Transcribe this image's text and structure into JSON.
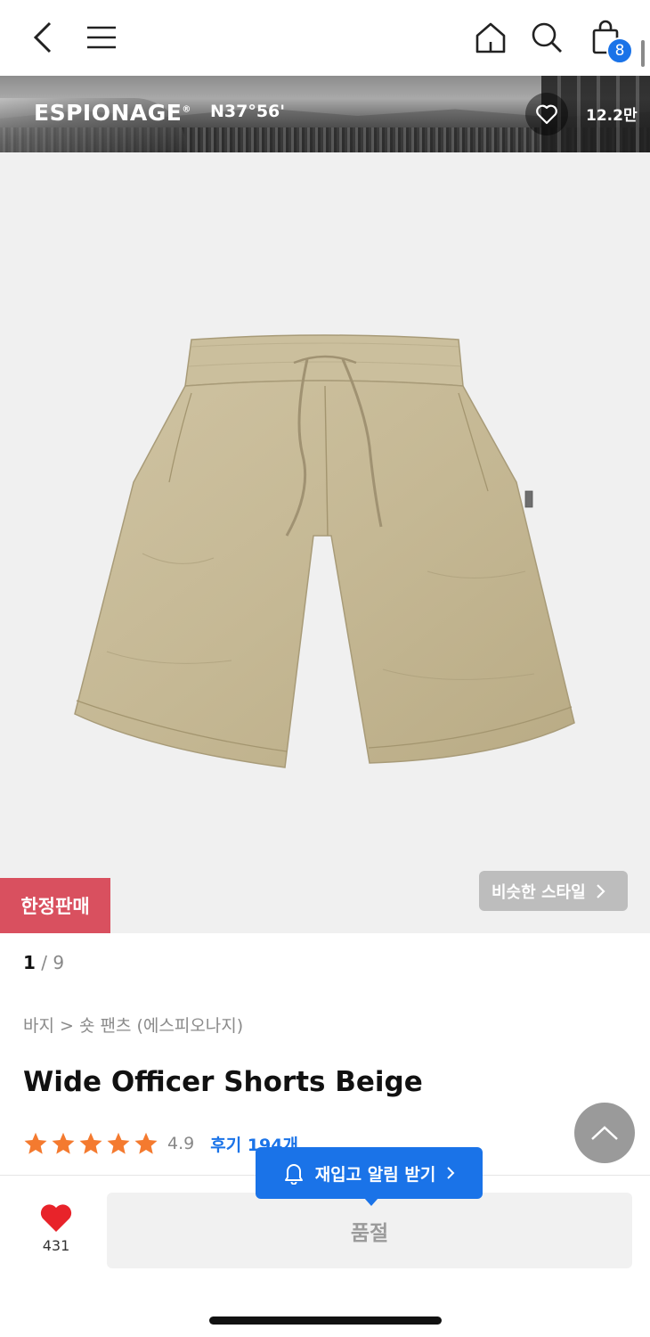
{
  "header": {
    "back_icon": "chevron-left-icon",
    "menu_icon": "hamburger-menu-icon",
    "home_icon": "home-icon",
    "search_icon": "search-icon",
    "cart_icon": "shopping-bag-icon",
    "cart_count": "8"
  },
  "brand": {
    "name": "ESPIONAGE",
    "registered_mark": "®",
    "coordinate": "N37°56'",
    "like_icon": "heart-outline-icon",
    "like_count": "12.2만"
  },
  "gallery": {
    "limited_label": "한정판매",
    "similar_label": "비슷한 스타일",
    "current_page": "1",
    "total_pages": "9"
  },
  "product": {
    "breadcrumb": "바지 > 숏 팬츠 (에스피오나지)",
    "title": "Wide Officer Shorts Beige",
    "rating": 4.9,
    "rating_text": "4.9",
    "stars": 5,
    "review_label": "후기 194개"
  },
  "bottom": {
    "like_count": "431",
    "soldout_label": "품절",
    "restock_label": "재입고 알림 받기",
    "restock_icon": "bell-icon"
  },
  "colors": {
    "accent_blue": "#1a73e8",
    "limited_red": "#d9505f",
    "star_orange": "#f47a2f",
    "heart_red": "#e8232a"
  }
}
